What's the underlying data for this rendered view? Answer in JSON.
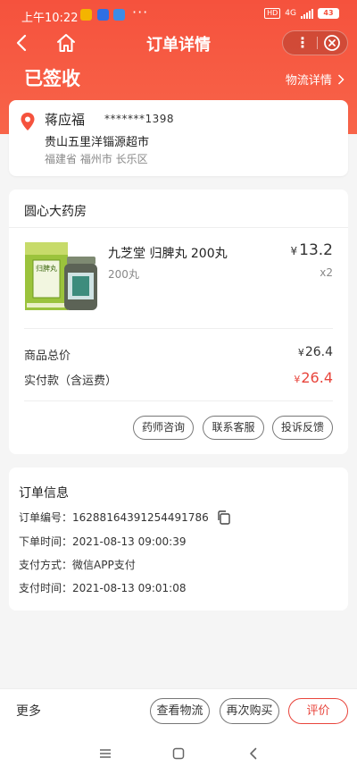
{
  "status_bar": {
    "time": "上午10:22",
    "dots": "···",
    "hd": "HD",
    "net": "4G",
    "battery": "43"
  },
  "nav": {
    "title": "订单详情",
    "back_icon": "back-arrow-icon",
    "home_icon": "home-icon",
    "more_icon": "more-vertical-icon",
    "close_icon": "close-circle-icon"
  },
  "order_status": {
    "label": "已签收",
    "logistics_link": "物流详情"
  },
  "address": {
    "name": "蒋应福",
    "phone": "*******1398",
    "street": "贵山五里洋锱源超市",
    "region": "福建省 福州市 长乐区",
    "icon": "location-pin-icon"
  },
  "shop": {
    "name": "圆心大药房",
    "product": {
      "name": "九芝堂 归脾丸 200丸",
      "spec": "200丸",
      "price_symbol": "¥",
      "price": "13.2",
      "qty": "x2",
      "box_text": "归脾丸"
    },
    "summary": [
      {
        "label": "商品总价",
        "symbol": "¥",
        "value": "26.4"
      },
      {
        "label": "实付款（含运费）",
        "symbol": "¥",
        "value": "26.4"
      }
    ],
    "actions": [
      "药师咨询",
      "联系客服",
      "投诉反馈"
    ]
  },
  "order_info": {
    "title": "订单信息",
    "rows": [
      {
        "label": "订单编号：",
        "value": "16288164391254491786"
      },
      {
        "label": "下单时间：",
        "value": "2021-08-13 09:00:39"
      },
      {
        "label": "支付方式：",
        "value": "微信APP支付"
      },
      {
        "label": "支付时间：",
        "value": "2021-08-13 09:01:08"
      }
    ],
    "copy_icon": "copy-icon"
  },
  "bottom_bar": {
    "more": "更多",
    "buttons": [
      "查看物流",
      "再次购买",
      "评价"
    ]
  },
  "colors": {
    "primary": "#f5523d",
    "price_red": "#e8453c"
  }
}
